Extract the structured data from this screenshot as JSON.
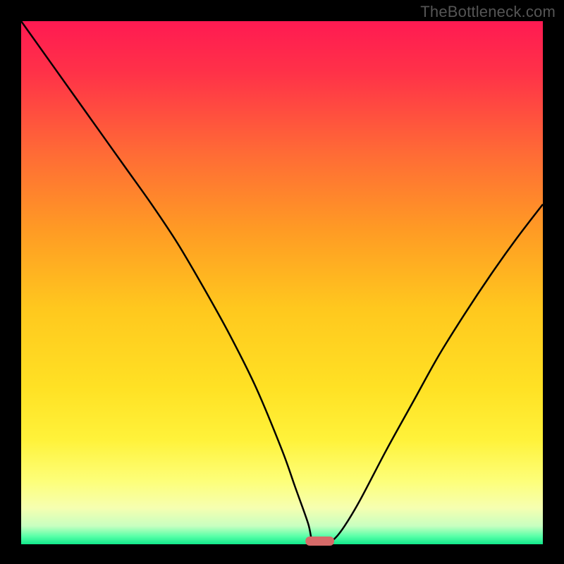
{
  "watermark": "TheBottleneck.com",
  "colors": {
    "frame_bg": "#000000",
    "curve_stroke": "#000000",
    "marker_fill": "#d66a68",
    "gradient_stops": [
      {
        "offset": 0.0,
        "color": "#ff1a52"
      },
      {
        "offset": 0.1,
        "color": "#ff3248"
      },
      {
        "offset": 0.25,
        "color": "#ff6a36"
      },
      {
        "offset": 0.4,
        "color": "#ff9b24"
      },
      {
        "offset": 0.55,
        "color": "#ffc81e"
      },
      {
        "offset": 0.7,
        "color": "#ffe124"
      },
      {
        "offset": 0.8,
        "color": "#fff23a"
      },
      {
        "offset": 0.88,
        "color": "#fdff7a"
      },
      {
        "offset": 0.93,
        "color": "#f6ffb0"
      },
      {
        "offset": 0.965,
        "color": "#c8ffc0"
      },
      {
        "offset": 0.985,
        "color": "#57ffa8"
      },
      {
        "offset": 1.0,
        "color": "#11e88a"
      }
    ]
  },
  "chart_data": {
    "type": "line",
    "title": "",
    "xlabel": "",
    "ylabel": "",
    "x": [
      0.0,
      0.05,
      0.1,
      0.15,
      0.2,
      0.25,
      0.3,
      0.35,
      0.4,
      0.45,
      0.5,
      0.525,
      0.55,
      0.56,
      0.58,
      0.6,
      0.62,
      0.65,
      0.7,
      0.75,
      0.8,
      0.85,
      0.9,
      0.95,
      1.0
    ],
    "values": [
      1.0,
      0.93,
      0.86,
      0.79,
      0.72,
      0.65,
      0.575,
      0.49,
      0.4,
      0.3,
      0.18,
      0.11,
      0.04,
      0.0,
      0.0,
      0.01,
      0.035,
      0.085,
      0.18,
      0.27,
      0.36,
      0.44,
      0.515,
      0.585,
      0.65
    ],
    "xlim": [
      0,
      1
    ],
    "ylim": [
      0,
      1
    ],
    "marker": {
      "x_start": 0.545,
      "x_end": 0.6,
      "y": 0.0
    }
  }
}
